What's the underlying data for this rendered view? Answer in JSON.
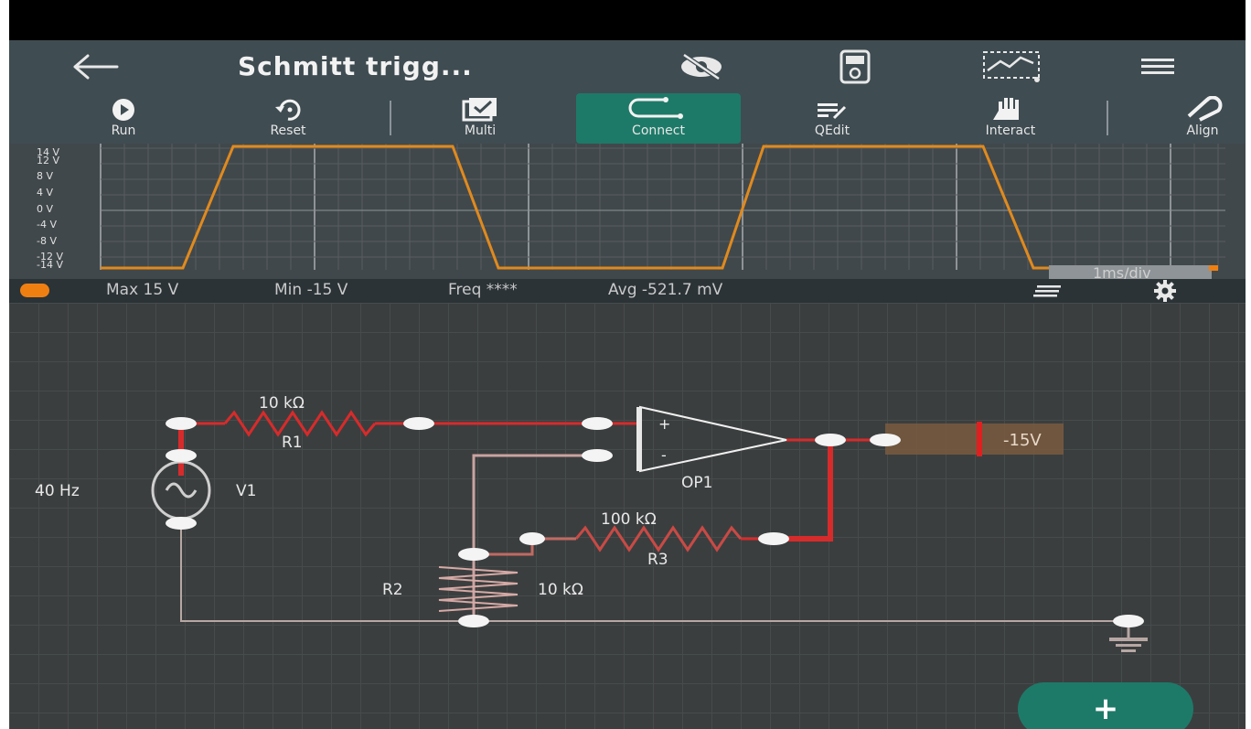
{
  "app_bar": {
    "title": "Schmitt trigg...",
    "back_icon": "arrow-left-icon",
    "icons": [
      "eye-off-icon",
      "multimeter-icon",
      "oscilloscope-icon",
      "menu-icon"
    ]
  },
  "toolbar": {
    "items": [
      {
        "label": "Run",
        "icon": "play-icon",
        "active": false
      },
      {
        "label": "Reset",
        "icon": "reset-icon",
        "active": false
      },
      {
        "label": "Multi",
        "icon": "multi-select-icon",
        "active": false
      },
      {
        "label": "Connect",
        "icon": "connect-icon",
        "active": true
      },
      {
        "label": "QEdit",
        "icon": "quick-edit-icon",
        "active": false
      },
      {
        "label": "Interact",
        "icon": "hand-icon",
        "active": false
      },
      {
        "label": "Align",
        "icon": "magnet-icon",
        "active": false
      }
    ],
    "active_color": "#1e7a68"
  },
  "scope": {
    "y_ticks": [
      "14 V",
      "12 V",
      "8 V",
      "4 V",
      "0 V",
      "-4 V",
      "-8 V",
      "-12 V",
      "-14 V"
    ],
    "time_div": "1ms/div",
    "trace_color": "#e08a1e"
  },
  "info": {
    "max": "Max  15 V",
    "min": "Min  -15 V",
    "freq": "Freq  ****",
    "avg": "Avg  -521.7 mV",
    "series_color": "#f07f12"
  },
  "circuit": {
    "r1_value": "10 kΩ",
    "r1_name": "R1",
    "r2_name": "R2",
    "r2_value": "10 kΩ",
    "r3_value": "100 kΩ",
    "r3_name": "R3",
    "v1_freq": "40 Hz",
    "v1_name": "V1",
    "op_name": "OP1",
    "probe_value": "-15V",
    "op_plus": "+",
    "op_minus": "-"
  },
  "fab": {
    "icon": "plus-icon",
    "label": "+",
    "color": "#1e7a68"
  }
}
